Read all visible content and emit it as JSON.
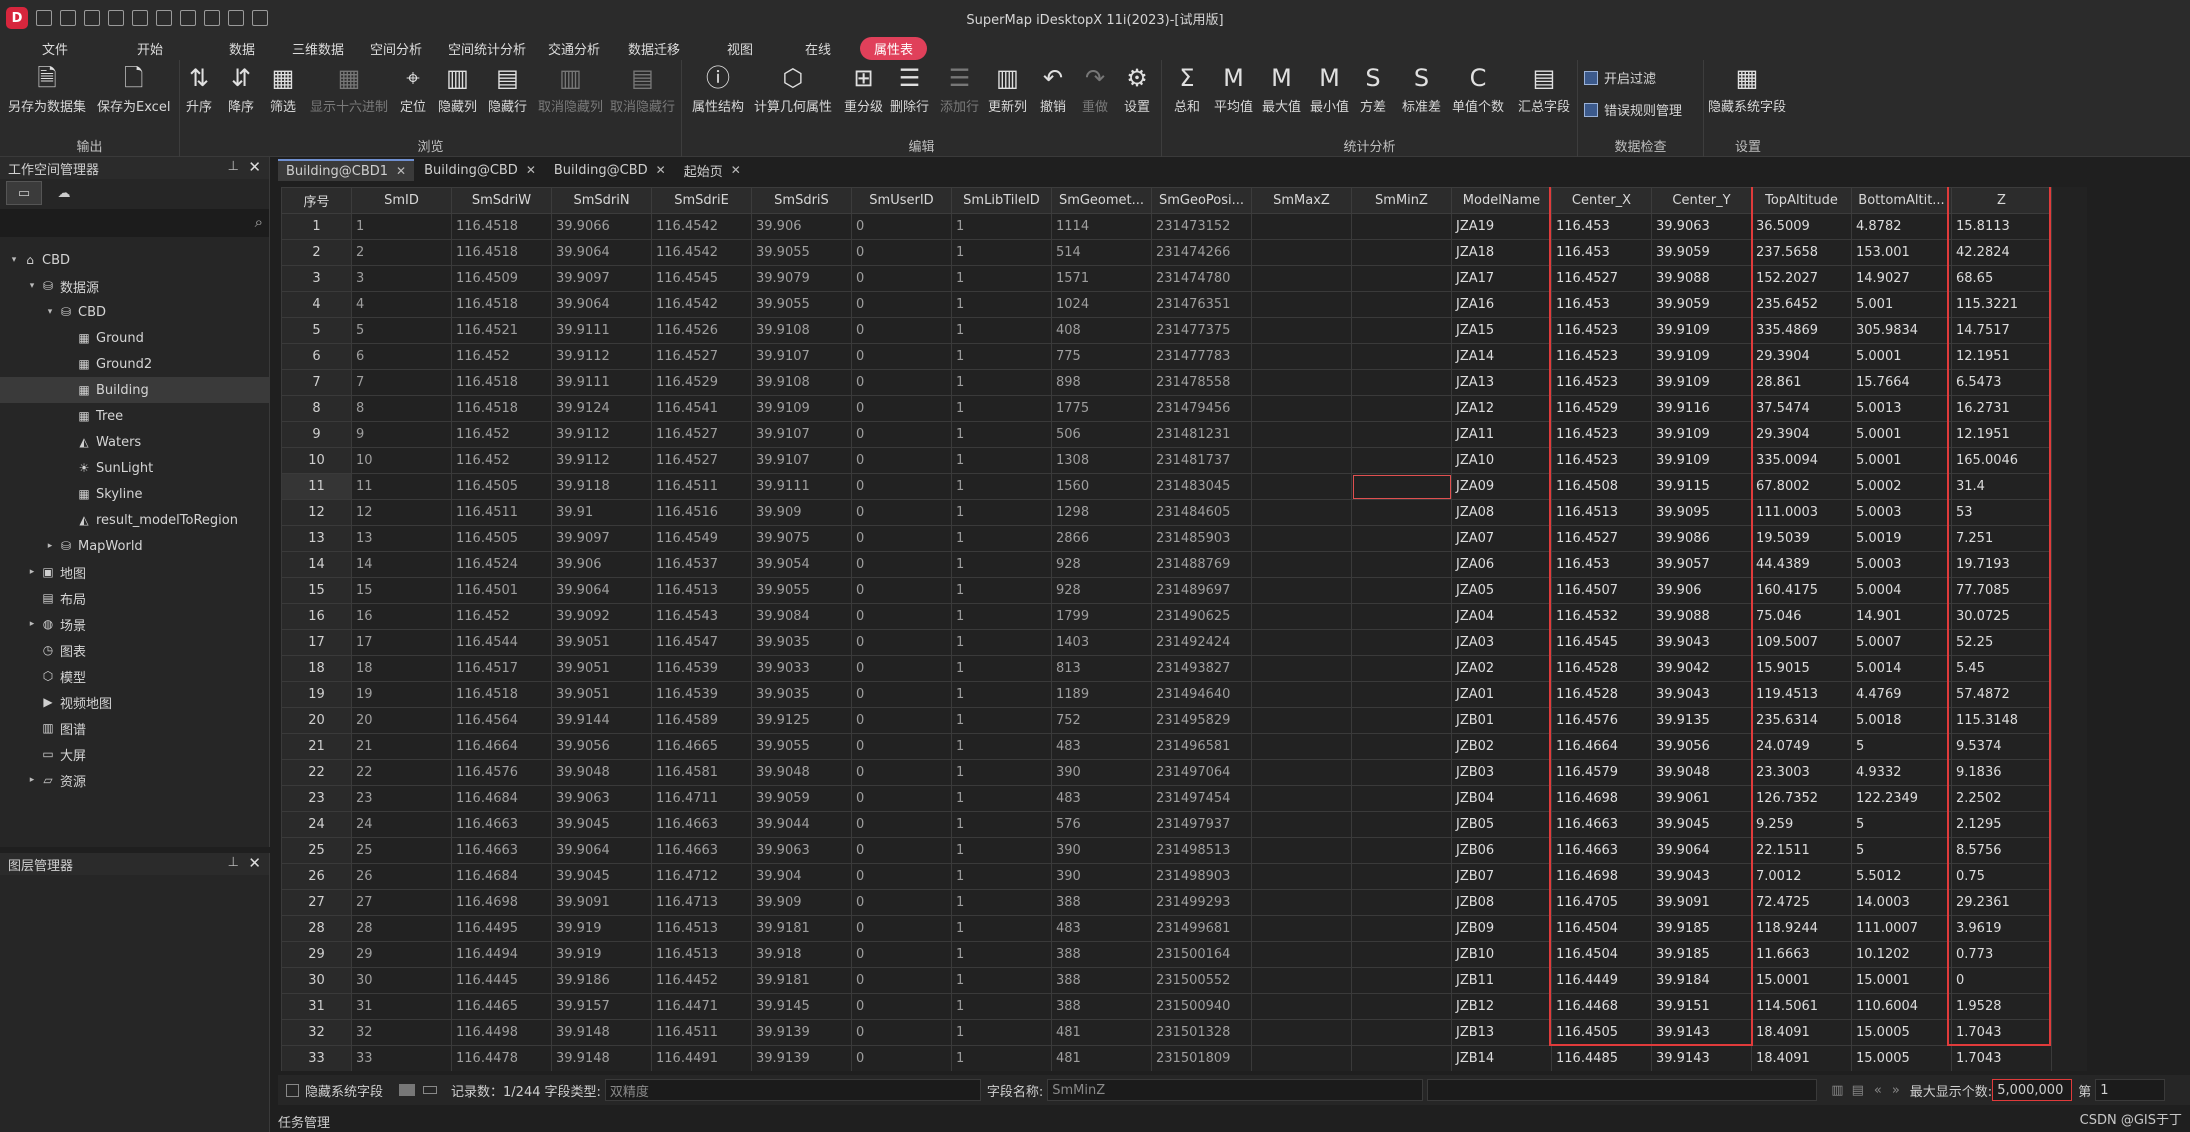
{
  "app": {
    "title": "SuperMap iDesktopX 11i(2023)-[试用版]",
    "logo_letter": "D"
  },
  "menu": [
    "文件",
    "开始",
    "数据",
    "三维数据",
    "空间分析",
    "空间统计分析",
    "交通分析",
    "数据迁移",
    "视图",
    "在线",
    "属性表"
  ],
  "menu_active": "属性表",
  "ribbon": {
    "groups": {
      "output": "输出",
      "browse": "浏览",
      "edit": "编辑",
      "stats": "统计分析",
      "check": "数据检查",
      "settings": "设置"
    },
    "buttons": {
      "save_dataset": "另存为数据集",
      "save_excel": "保存为Excel",
      "asc": "升序",
      "desc": "降序",
      "filter": "筛选",
      "hex": "显示十六进制",
      "locate": "定位",
      "hide_col": "隐藏列",
      "hide_row": "隐藏行",
      "unhide_col": "取消隐藏列",
      "unhide_row": "取消隐藏行",
      "struct": "属性结构",
      "calc_geom": "计算几何属性",
      "reclass": "重分级",
      "del_row": "删除行",
      "add_row": "添加行",
      "update_col": "更新列",
      "undo": "撤销",
      "redo": "重做",
      "settings": "设置",
      "sum": "总和",
      "avg": "平均值",
      "max": "最大值",
      "min": "最小值",
      "var": "方差",
      "std": "标准差",
      "count": "单值个数",
      "summary": "汇总字段",
      "open_filter": "开启过滤",
      "error_rules": "错误规则管理",
      "hide_sys": "隐藏系统字段"
    }
  },
  "workspace": {
    "title": "工作空间管理器",
    "tree": [
      {
        "label": "CBD",
        "level": 0,
        "expand": "▾",
        "icon": "⌂",
        "iname": "workspace-icon"
      },
      {
        "label": "数据源",
        "level": 1,
        "expand": "▾",
        "icon": "⛁",
        "iname": "datasources-icon"
      },
      {
        "label": "CBD",
        "level": 2,
        "expand": "▾",
        "icon": "⛁",
        "iname": "datasource-icon"
      },
      {
        "label": "Ground",
        "level": 3,
        "expand": "",
        "icon": "▦",
        "iname": "model-dataset-icon"
      },
      {
        "label": "Ground2",
        "level": 3,
        "expand": "",
        "icon": "▦",
        "iname": "model-dataset-icon"
      },
      {
        "label": "Building",
        "level": 3,
        "expand": "",
        "icon": "▦",
        "iname": "model-dataset-icon",
        "selected": true
      },
      {
        "label": "Tree",
        "level": 3,
        "expand": "",
        "icon": "▦",
        "iname": "model-dataset-icon"
      },
      {
        "label": "Waters",
        "level": 3,
        "expand": "",
        "icon": "◭",
        "iname": "region-dataset-icon"
      },
      {
        "label": "SunLight",
        "level": 3,
        "expand": "",
        "icon": "☀",
        "iname": "sunlight-dataset-icon"
      },
      {
        "label": "Skyline",
        "level": 3,
        "expand": "",
        "icon": "▦",
        "iname": "model-dataset-icon"
      },
      {
        "label": "result_modelToRegion",
        "level": 3,
        "expand": "",
        "icon": "◭",
        "iname": "region-dataset-icon"
      },
      {
        "label": "MapWorld",
        "level": 2,
        "expand": "▸",
        "icon": "⛁",
        "iname": "datasource-icon"
      },
      {
        "label": "地图",
        "level": 1,
        "expand": "▸",
        "icon": "▣",
        "iname": "maps-icon"
      },
      {
        "label": "布局",
        "level": 1,
        "expand": "",
        "icon": "▤",
        "iname": "layouts-icon"
      },
      {
        "label": "场景",
        "level": 1,
        "expand": "▸",
        "icon": "◍",
        "iname": "scenes-icon"
      },
      {
        "label": "图表",
        "level": 1,
        "expand": "",
        "icon": "◷",
        "iname": "charts-icon"
      },
      {
        "label": "模型",
        "level": 1,
        "expand": "",
        "icon": "⬡",
        "iname": "models-icon"
      },
      {
        "label": "视频地图",
        "level": 1,
        "expand": "",
        "icon": "▶",
        "iname": "video-maps-icon"
      },
      {
        "label": "图谱",
        "level": 1,
        "expand": "",
        "icon": "▥",
        "iname": "graphs-icon"
      },
      {
        "label": "大屏",
        "level": 1,
        "expand": "",
        "icon": "▭",
        "iname": "big-screen-icon"
      },
      {
        "label": "资源",
        "level": 1,
        "expand": "▸",
        "icon": "▱",
        "iname": "resources-icon"
      }
    ]
  },
  "layer_panel": {
    "title": "图层管理器"
  },
  "doc_tabs": [
    {
      "label": "Building@CBD1",
      "active": true,
      "closable": true
    },
    {
      "label": "Building@CBD",
      "active": false,
      "closable": true
    },
    {
      "label": "Building@CBD",
      "active": false,
      "closable": true
    },
    {
      "label": "起始页",
      "active": false,
      "closable": true
    }
  ],
  "table": {
    "columns": [
      "序号",
      "SmID",
      "SmSdriW",
      "SmSdriN",
      "SmSdriE",
      "SmSdriS",
      "SmUserID",
      "SmLibTileID",
      "SmGeomet...",
      "SmGeoPosi...",
      "SmMaxZ",
      "SmMinZ",
      "ModelName",
      "Center_X",
      "Center_Y",
      "TopAltitude",
      "BottomAltit...",
      "Z"
    ],
    "rows": [
      [
        "1",
        "1",
        "116.4518",
        "39.9066",
        "116.4542",
        "39.906",
        "0",
        "1",
        "1114",
        "231473152",
        "",
        "",
        "JZA19",
        "116.453",
        "39.9063",
        "36.5009",
        "4.8782",
        "15.8113"
      ],
      [
        "2",
        "2",
        "116.4518",
        "39.9064",
        "116.4542",
        "39.9055",
        "0",
        "1",
        "514",
        "231474266",
        "",
        "",
        "JZA18",
        "116.453",
        "39.9059",
        "237.5658",
        "153.001",
        "42.2824"
      ],
      [
        "3",
        "3",
        "116.4509",
        "39.9097",
        "116.4545",
        "39.9079",
        "0",
        "1",
        "1571",
        "231474780",
        "",
        "",
        "JZA17",
        "116.4527",
        "39.9088",
        "152.2027",
        "14.9027",
        "68.65"
      ],
      [
        "4",
        "4",
        "116.4518",
        "39.9064",
        "116.4542",
        "39.9055",
        "0",
        "1",
        "1024",
        "231476351",
        "",
        "",
        "JZA16",
        "116.453",
        "39.9059",
        "235.6452",
        "5.001",
        "115.3221"
      ],
      [
        "5",
        "5",
        "116.4521",
        "39.9111",
        "116.4526",
        "39.9108",
        "0",
        "1",
        "408",
        "231477375",
        "",
        "",
        "JZA15",
        "116.4523",
        "39.9109",
        "335.4869",
        "305.9834",
        "14.7517"
      ],
      [
        "6",
        "6",
        "116.452",
        "39.9112",
        "116.4527",
        "39.9107",
        "0",
        "1",
        "775",
        "231477783",
        "",
        "",
        "JZA14",
        "116.4523",
        "39.9109",
        "29.3904",
        "5.0001",
        "12.1951"
      ],
      [
        "7",
        "7",
        "116.4518",
        "39.9111",
        "116.4529",
        "39.9108",
        "0",
        "1",
        "898",
        "231478558",
        "",
        "",
        "JZA13",
        "116.4523",
        "39.9109",
        "28.861",
        "15.7664",
        "6.5473"
      ],
      [
        "8",
        "8",
        "116.4518",
        "39.9124",
        "116.4541",
        "39.9109",
        "0",
        "1",
        "1775",
        "231479456",
        "",
        "",
        "JZA12",
        "116.4529",
        "39.9116",
        "37.5474",
        "5.0013",
        "16.2731"
      ],
      [
        "9",
        "9",
        "116.452",
        "39.9112",
        "116.4527",
        "39.9107",
        "0",
        "1",
        "506",
        "231481231",
        "",
        "",
        "JZA11",
        "116.4523",
        "39.9109",
        "29.3904",
        "5.0001",
        "12.1951"
      ],
      [
        "10",
        "10",
        "116.452",
        "39.9112",
        "116.4527",
        "39.9107",
        "0",
        "1",
        "1308",
        "231481737",
        "",
        "",
        "JZA10",
        "116.4523",
        "39.9109",
        "335.0094",
        "5.0001",
        "165.0046"
      ],
      [
        "11",
        "11",
        "116.4505",
        "39.9118",
        "116.4511",
        "39.9111",
        "0",
        "1",
        "1560",
        "231483045",
        "",
        "",
        "JZA09",
        "116.4508",
        "39.9115",
        "67.8002",
        "5.0002",
        "31.4"
      ],
      [
        "12",
        "12",
        "116.4511",
        "39.91",
        "116.4516",
        "39.909",
        "0",
        "1",
        "1298",
        "231484605",
        "",
        "",
        "JZA08",
        "116.4513",
        "39.9095",
        "111.0003",
        "5.0003",
        "53"
      ],
      [
        "13",
        "13",
        "116.4505",
        "39.9097",
        "116.4549",
        "39.9075",
        "0",
        "1",
        "2866",
        "231485903",
        "",
        "",
        "JZA07",
        "116.4527",
        "39.9086",
        "19.5039",
        "5.0019",
        "7.251"
      ],
      [
        "14",
        "14",
        "116.4524",
        "39.906",
        "116.4537",
        "39.9054",
        "0",
        "1",
        "928",
        "231488769",
        "",
        "",
        "JZA06",
        "116.453",
        "39.9057",
        "44.4389",
        "5.0003",
        "19.7193"
      ],
      [
        "15",
        "15",
        "116.4501",
        "39.9064",
        "116.4513",
        "39.9055",
        "0",
        "1",
        "928",
        "231489697",
        "",
        "",
        "JZA05",
        "116.4507",
        "39.906",
        "160.4175",
        "5.0004",
        "77.7085"
      ],
      [
        "16",
        "16",
        "116.452",
        "39.9092",
        "116.4543",
        "39.9084",
        "0",
        "1",
        "1799",
        "231490625",
        "",
        "",
        "JZA04",
        "116.4532",
        "39.9088",
        "75.046",
        "14.901",
        "30.0725"
      ],
      [
        "17",
        "17",
        "116.4544",
        "39.9051",
        "116.4547",
        "39.9035",
        "0",
        "1",
        "1403",
        "231492424",
        "",
        "",
        "JZA03",
        "116.4545",
        "39.9043",
        "109.5007",
        "5.0007",
        "52.25"
      ],
      [
        "18",
        "18",
        "116.4517",
        "39.9051",
        "116.4539",
        "39.9033",
        "0",
        "1",
        "813",
        "231493827",
        "",
        "",
        "JZA02",
        "116.4528",
        "39.9042",
        "15.9015",
        "5.0014",
        "5.45"
      ],
      [
        "19",
        "19",
        "116.4518",
        "39.9051",
        "116.4539",
        "39.9035",
        "0",
        "1",
        "1189",
        "231494640",
        "",
        "",
        "JZA01",
        "116.4528",
        "39.9043",
        "119.4513",
        "4.4769",
        "57.4872"
      ],
      [
        "20",
        "20",
        "116.4564",
        "39.9144",
        "116.4589",
        "39.9125",
        "0",
        "1",
        "752",
        "231495829",
        "",
        "",
        "JZB01",
        "116.4576",
        "39.9135",
        "235.6314",
        "5.0018",
        "115.3148"
      ],
      [
        "21",
        "21",
        "116.4664",
        "39.9056",
        "116.4665",
        "39.9055",
        "0",
        "1",
        "483",
        "231496581",
        "",
        "",
        "JZB02",
        "116.4664",
        "39.9056",
        "24.0749",
        "5",
        "9.5374"
      ],
      [
        "22",
        "22",
        "116.4576",
        "39.9048",
        "116.4581",
        "39.9048",
        "0",
        "1",
        "390",
        "231497064",
        "",
        "",
        "JZB03",
        "116.4579",
        "39.9048",
        "23.3003",
        "4.9332",
        "9.1836"
      ],
      [
        "23",
        "23",
        "116.4684",
        "39.9063",
        "116.4711",
        "39.9059",
        "0",
        "1",
        "483",
        "231497454",
        "",
        "",
        "JZB04",
        "116.4698",
        "39.9061",
        "126.7352",
        "122.2349",
        "2.2502"
      ],
      [
        "24",
        "24",
        "116.4663",
        "39.9045",
        "116.4663",
        "39.9044",
        "0",
        "1",
        "576",
        "231497937",
        "",
        "",
        "JZB05",
        "116.4663",
        "39.9045",
        "9.259",
        "5",
        "2.1295"
      ],
      [
        "25",
        "25",
        "116.4663",
        "39.9064",
        "116.4663",
        "39.9063",
        "0",
        "1",
        "390",
        "231498513",
        "",
        "",
        "JZB06",
        "116.4663",
        "39.9064",
        "22.1511",
        "5",
        "8.5756"
      ],
      [
        "26",
        "26",
        "116.4684",
        "39.9045",
        "116.4712",
        "39.904",
        "0",
        "1",
        "390",
        "231498903",
        "",
        "",
        "JZB07",
        "116.4698",
        "39.9043",
        "7.0012",
        "5.5012",
        "0.75"
      ],
      [
        "27",
        "27",
        "116.4698",
        "39.9091",
        "116.4713",
        "39.909",
        "0",
        "1",
        "388",
        "231499293",
        "",
        "",
        "JZB08",
        "116.4705",
        "39.9091",
        "72.4725",
        "14.0003",
        "29.2361"
      ],
      [
        "28",
        "28",
        "116.4495",
        "39.919",
        "116.4513",
        "39.9181",
        "0",
        "1",
        "483",
        "231499681",
        "",
        "",
        "JZB09",
        "116.4504",
        "39.9185",
        "118.9244",
        "111.0007",
        "3.9619"
      ],
      [
        "29",
        "29",
        "116.4494",
        "39.919",
        "116.4513",
        "39.918",
        "0",
        "1",
        "388",
        "231500164",
        "",
        "",
        "JZB10",
        "116.4504",
        "39.9185",
        "11.6663",
        "10.1202",
        "0.773"
      ],
      [
        "30",
        "30",
        "116.4445",
        "39.9186",
        "116.4452",
        "39.9181",
        "0",
        "1",
        "388",
        "231500552",
        "",
        "",
        "JZB11",
        "116.4449",
        "39.9184",
        "15.0001",
        "15.0001",
        "0"
      ],
      [
        "31",
        "31",
        "116.4465",
        "39.9157",
        "116.4471",
        "39.9145",
        "0",
        "1",
        "388",
        "231500940",
        "",
        "",
        "JZB12",
        "116.4468",
        "39.9151",
        "114.5061",
        "110.6004",
        "1.9528"
      ],
      [
        "32",
        "32",
        "116.4498",
        "39.9148",
        "116.4511",
        "39.9139",
        "0",
        "1",
        "481",
        "231501328",
        "",
        "",
        "JZB13",
        "116.4505",
        "39.9143",
        "18.4091",
        "15.0005",
        "1.7043"
      ],
      [
        "33",
        "33",
        "116.4478",
        "39.9148",
        "116.4491",
        "39.9139",
        "0",
        "1",
        "481",
        "231501809",
        "",
        "",
        "JZB14",
        "116.4485",
        "39.9143",
        "18.4091",
        "15.0005",
        "1.7043"
      ]
    ]
  },
  "status": {
    "hide_sys_fields": "隐藏系统字段",
    "records": "记录数：1/244",
    "field_type_label": "字段类型:",
    "field_type_value": "双精度",
    "field_name_label": "字段名称:",
    "field_name_value": "SmMinZ",
    "max_display_label": "最大显示个数:",
    "max_display_value": "5,000,000",
    "page_label": "第",
    "page_value": "1"
  },
  "taskbar": {
    "label": "任务管理"
  },
  "watermark": "CSDN @GIS于丁",
  "colors": {
    "accent": "#e0405a",
    "highlight_box": "#e03b3b"
  }
}
